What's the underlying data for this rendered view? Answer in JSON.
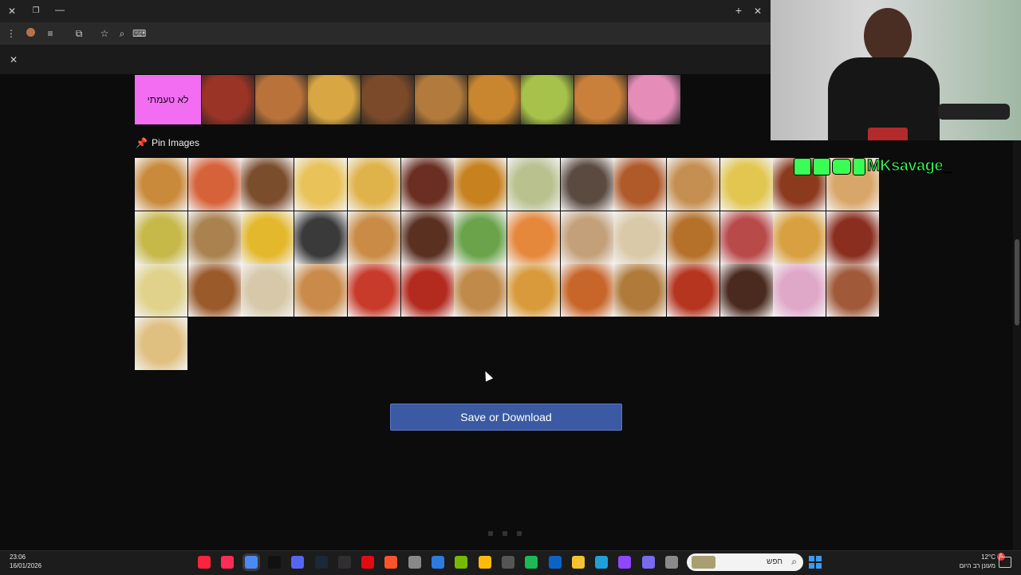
{
  "window": {
    "close_glyph": "✕",
    "restore_glyph": "❐",
    "minimize_glyph": "—",
    "new_tab_glyph": "+",
    "tab_close_glyph": "✕"
  },
  "toolbar": {
    "icons": [
      "menu-dots-icon",
      "profile-avatar-icon",
      "tab-search-icon",
      "extensions-icon",
      "bookmark-star-icon",
      "zoom-icon",
      "translate-icon"
    ]
  },
  "infobar": {
    "close_glyph": "✕"
  },
  "tier": {
    "label": "לא טעמתי"
  },
  "tier_images": [
    {
      "name": "bacon",
      "color": "#9a3426"
    },
    {
      "name": "pie",
      "color": "#b8723a"
    },
    {
      "name": "taco",
      "color": "#d8a642"
    },
    {
      "name": "hash-browns",
      "color": "#7a4a2b"
    },
    {
      "name": "waffles",
      "color": "#b27a3c"
    },
    {
      "name": "cheeseburger",
      "color": "#c9862f"
    },
    {
      "name": "knafeh",
      "color": "#a7c24a"
    },
    {
      "name": "fried-sticks",
      "color": "#c9803a"
    },
    {
      "name": "donuts",
      "color": "#e58cb8"
    }
  ],
  "pin": {
    "icon": "📌",
    "title": "Pin Images"
  },
  "food_images": [
    {
      "name": "cigars",
      "color": "#c98a3c"
    },
    {
      "name": "pizza",
      "color": "#d6623a"
    },
    {
      "name": "muffin",
      "color": "#7a4d2c"
    },
    {
      "name": "fried-egg",
      "color": "#e9c25a"
    },
    {
      "name": "omelette",
      "color": "#e0b24a"
    },
    {
      "name": "steak",
      "color": "#6a2f22"
    },
    {
      "name": "honey",
      "color": "#c7811f"
    },
    {
      "name": "pasta-salad",
      "color": "#b9c28f"
    },
    {
      "name": "fish",
      "color": "#5a4a40"
    },
    {
      "name": "meatballs",
      "color": "#b05a2a"
    },
    {
      "name": "bagels",
      "color": "#c68f52"
    },
    {
      "name": "corn",
      "color": "#e2c650"
    },
    {
      "name": "wings",
      "color": "#8b3a1e"
    },
    {
      "name": "toast",
      "color": "#d9a66a"
    },
    {
      "name": "soup",
      "color": "#c7b84a"
    },
    {
      "name": "chicken-breast",
      "color": "#a9824f"
    },
    {
      "name": "corn-kernels",
      "color": "#e4b82d"
    },
    {
      "name": "caviar",
      "color": "#3a3a3a"
    },
    {
      "name": "pancakes",
      "color": "#c98b45"
    },
    {
      "name": "brownies",
      "color": "#5a3021"
    },
    {
      "name": "salad",
      "color": "#6aa34a"
    },
    {
      "name": "fruit-salad",
      "color": "#e6883c"
    },
    {
      "name": "dumplings",
      "color": "#c3a07a"
    },
    {
      "name": "fish-fillet",
      "color": "#d9c9a8"
    },
    {
      "name": "fritters",
      "color": "#b5702a"
    },
    {
      "name": "parfait",
      "color": "#b84a4a"
    },
    {
      "name": "grilled-cheese",
      "color": "#d8a040"
    },
    {
      "name": "kofta-stew",
      "color": "#8a2f1f"
    },
    {
      "name": "mashed-potatoes",
      "color": "#e0d28a"
    },
    {
      "name": "schnitzel",
      "color": "#9a5a2a"
    },
    {
      "name": "hummus",
      "color": "#d6c8a8"
    },
    {
      "name": "penne",
      "color": "#c98a4a"
    },
    {
      "name": "stuffed-peppers",
      "color": "#c83a2a"
    },
    {
      "name": "tomato-sauce",
      "color": "#b32a1e"
    },
    {
      "name": "quiche",
      "color": "#c08a4a"
    },
    {
      "name": "rice",
      "color": "#d89a3a"
    },
    {
      "name": "stuffed-zucchini",
      "color": "#c8662a"
    },
    {
      "name": "casserole",
      "color": "#b07a3a"
    },
    {
      "name": "shakshuka",
      "color": "#b5351f"
    },
    {
      "name": "chocolate-cake",
      "color": "#4a2a1e"
    },
    {
      "name": "ice-cream",
      "color": "#e0a8c8"
    },
    {
      "name": "sausage",
      "color": "#a05a3a"
    },
    {
      "name": "crepe",
      "color": "#e0c080"
    }
  ],
  "save": {
    "label": "Save or Download"
  },
  "overlay": {
    "handle": "MKsavage_"
  },
  "taskbar": {
    "time": "23:06",
    "date": "16/01/2026",
    "search_placeholder": "חפש",
    "temperature": "12°C",
    "weather_text": "מעונן רב היום",
    "notification_count": "6",
    "apps": [
      {
        "name": "apple-music",
        "color": "#fa243c"
      },
      {
        "name": "tiktok-studio",
        "color": "#ff2d55"
      },
      {
        "name": "chrome-active",
        "color": "#4a8af4"
      },
      {
        "name": "tiktok",
        "color": "#111111"
      },
      {
        "name": "discord",
        "color": "#5865f2"
      },
      {
        "name": "steam",
        "color": "#1b2838"
      },
      {
        "name": "obs",
        "color": "#302e31"
      },
      {
        "name": "netflix",
        "color": "#e50914"
      },
      {
        "name": "brave",
        "color": "#fb542b"
      },
      {
        "name": "app-circle",
        "color": "#888888"
      },
      {
        "name": "app-blue",
        "color": "#2d7be0"
      },
      {
        "name": "nvidia",
        "color": "#76b900"
      },
      {
        "name": "chrome",
        "color": "#fbbc05"
      },
      {
        "name": "store",
        "color": "#555555"
      },
      {
        "name": "spotify",
        "color": "#1db954"
      },
      {
        "name": "outlook",
        "color": "#0a64c8"
      },
      {
        "name": "explorer",
        "color": "#f4c430"
      },
      {
        "name": "edge",
        "color": "#1fa0d8"
      },
      {
        "name": "twitch",
        "color": "#9146ff"
      },
      {
        "name": "copilot",
        "color": "#7a6af0"
      },
      {
        "name": "app-gray",
        "color": "#8a8a8a"
      }
    ]
  }
}
